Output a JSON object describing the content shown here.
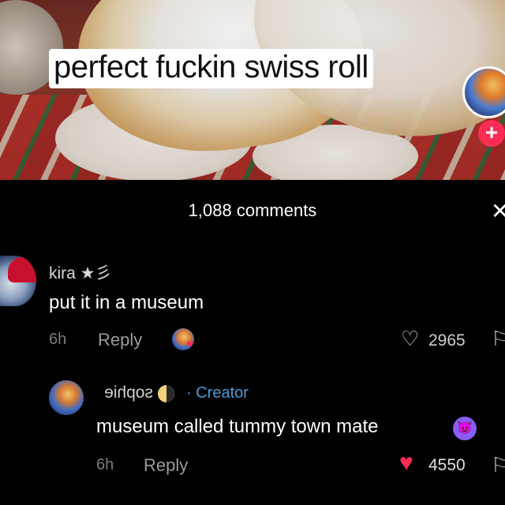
{
  "video": {
    "caption": "perfect fuckin swiss roll",
    "follow_symbol": "+"
  },
  "comments_panel": {
    "count_label": "1,088 comments",
    "close_symbol": "✕"
  },
  "comments": [
    {
      "username": "kira ★彡",
      "text": "put it in a museum",
      "time": "6h",
      "reply_label": "Reply",
      "likes": "2965",
      "liked_by_creator": true
    },
    {
      "username": "sophie",
      "creator_badge": "· Creator",
      "text": "museum called tummy town mate",
      "time": "6h",
      "reply_label": "Reply",
      "likes": "4550",
      "liked": true
    }
  ],
  "colors": {
    "accent": "#fe2c55",
    "creator_blue": "#4a9bd8",
    "background": "#000000"
  },
  "icons": [
    "close-icon",
    "heart-outline-icon",
    "heart-filled-icon",
    "dislike-icon",
    "follow-plus-icon",
    "devil-emoji-icon",
    "moon-emoji-icon"
  ]
}
